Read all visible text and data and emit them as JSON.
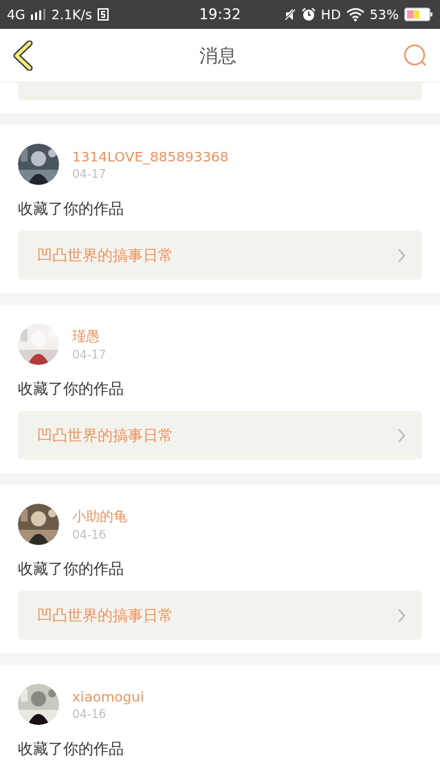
{
  "status_bar": {
    "network": "4G",
    "speed": "2.1K/s",
    "time": "19:32",
    "hd": "HD",
    "battery": "53%"
  },
  "header": {
    "title": "消息"
  },
  "messages": [
    {
      "user": "1314LOVE_885893368",
      "date": "04-17",
      "action": "收藏了你的作品",
      "work": "凹凸世界的搞事日常"
    },
    {
      "user": "瑾愚",
      "date": "04-17",
      "action": "收藏了你的作品",
      "work": "凹凸世界的搞事日常"
    },
    {
      "user": "小助的龟",
      "date": "04-16",
      "action": "收藏了你的作品",
      "work": "凹凸世界的搞事日常"
    },
    {
      "user": "xiaomogui",
      "date": "04-16",
      "action": "收藏了你的作品"
    }
  ]
}
